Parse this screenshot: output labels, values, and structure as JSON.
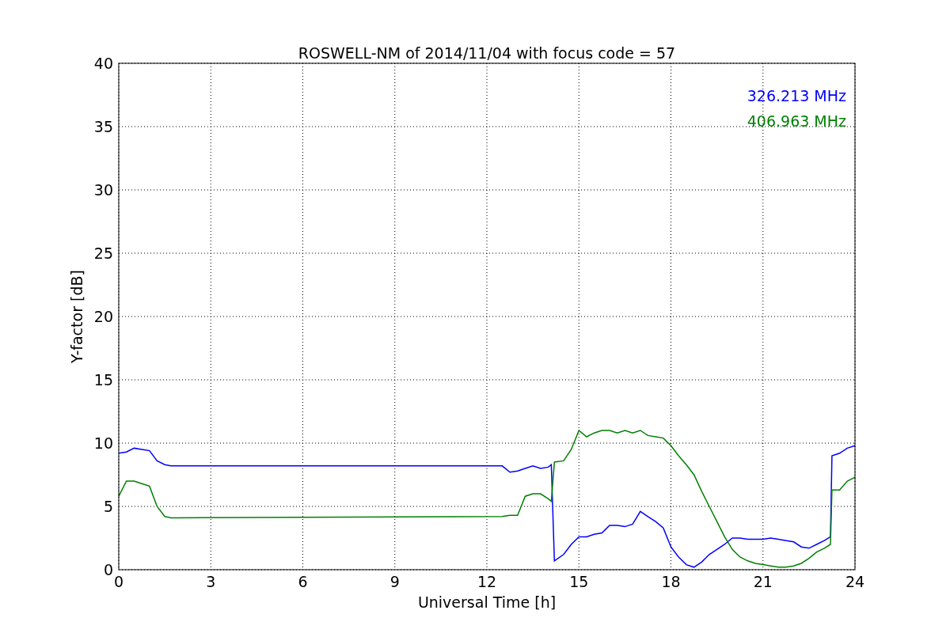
{
  "chart_data": {
    "type": "line",
    "title": "ROSWELL-NM of 2014/11/04 with focus code = 57",
    "xlabel": "Universal Time [h]",
    "ylabel": "Y-factor [dB]",
    "x": [
      0,
      0.25,
      0.5,
      0.75,
      1,
      1.25,
      1.5,
      1.7,
      12.5,
      12.75,
      13,
      13.25,
      13.5,
      13.75,
      14,
      14.1,
      14.2,
      14.5,
      14.75,
      15,
      15.25,
      15.5,
      15.75,
      16,
      16.25,
      16.5,
      16.75,
      17,
      17.25,
      17.5,
      17.75,
      18,
      18.25,
      18.5,
      18.75,
      19,
      19.25,
      19.5,
      19.75,
      20,
      20.25,
      20.5,
      20.75,
      21,
      21.25,
      21.5,
      21.75,
      22,
      22.25,
      22.5,
      22.75,
      23,
      23.2,
      23.25,
      23.5,
      23.75,
      24
    ],
    "series": [
      {
        "name": "326.213 MHz",
        "color": "#0000ff",
        "values": [
          9.2,
          9.3,
          9.6,
          9.5,
          9.4,
          8.6,
          8.3,
          8.2,
          8.2,
          7.7,
          7.8,
          8,
          8.2,
          8,
          8.1,
          8.3,
          0.7,
          1.2,
          2,
          2.6,
          2.6,
          2.8,
          2.9,
          3.5,
          3.5,
          3.4,
          3.6,
          4.6,
          4.2,
          3.8,
          3.3,
          1.8,
          1,
          0.4,
          0.2,
          0.6,
          1.2,
          1.6,
          2,
          2.5,
          2.5,
          2.4,
          2.4,
          2.4,
          2.5,
          2.4,
          2.3,
          2.2,
          1.8,
          1.7,
          2,
          2.3,
          2.6,
          9,
          9.2,
          9.6,
          9.8
        ]
      },
      {
        "name": "406.963 MHz",
        "color": "#008000",
        "values": [
          5.8,
          7,
          7,
          6.8,
          6.6,
          5,
          4.2,
          4.1,
          4.2,
          4.3,
          4.3,
          5.8,
          6,
          6,
          5.6,
          5.4,
          8.5,
          8.6,
          9.5,
          11,
          10.5,
          10.8,
          11,
          11,
          10.8,
          11,
          10.8,
          11,
          10.6,
          10.5,
          10.4,
          9.8,
          9,
          8.3,
          7.5,
          6.2,
          5,
          3.8,
          2.6,
          1.6,
          1,
          0.7,
          0.5,
          0.4,
          0.3,
          0.2,
          0.2,
          0.3,
          0.5,
          0.9,
          1.4,
          1.7,
          2,
          6.3,
          6.3,
          7,
          7.3
        ]
      }
    ],
    "xlim": [
      0,
      24
    ],
    "ylim": [
      0,
      40
    ],
    "xticks": [
      0,
      3,
      6,
      9,
      12,
      15,
      18,
      21,
      24
    ],
    "yticks": [
      0,
      5,
      10,
      15,
      20,
      25,
      30,
      35,
      40
    ],
    "grid": true
  }
}
